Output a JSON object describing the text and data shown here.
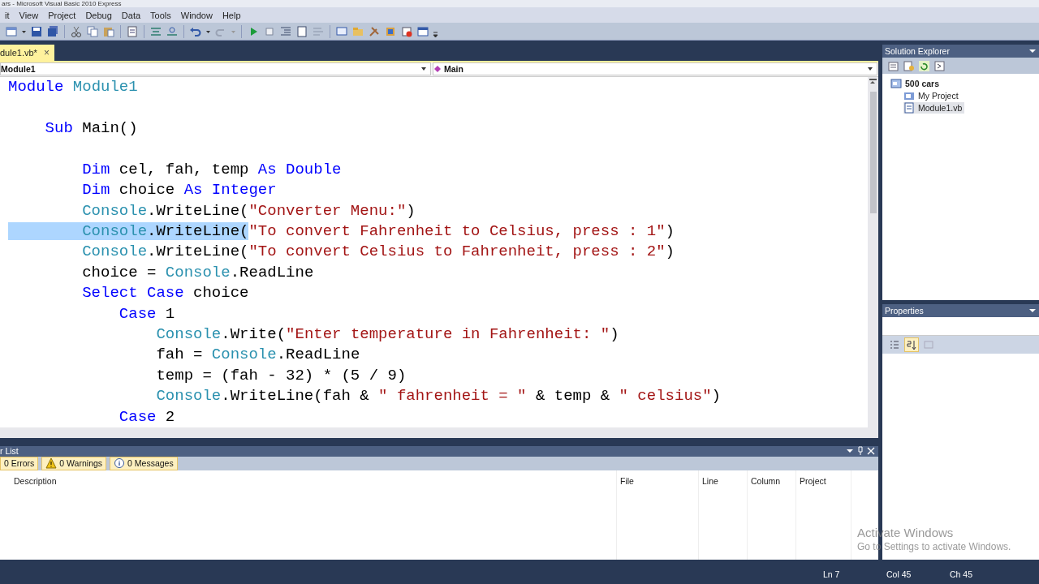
{
  "window": {
    "title": "ars - Microsoft Visual Basic 2010 Express"
  },
  "menu": [
    "it",
    "View",
    "Project",
    "Debug",
    "Data",
    "Tools",
    "Window",
    "Help"
  ],
  "document_tabs": [
    {
      "label": "dule1.vb*",
      "close": "×",
      "selected": true
    }
  ],
  "navigation": {
    "type_dropdown": "Module1",
    "member_dropdown": "Main"
  },
  "code_lines": [
    {
      "kind": "code",
      "tokens": [
        {
          "kind": "keyword",
          "text": "Module"
        },
        {
          "kind": "type",
          "text": " Module1"
        }
      ]
    },
    {
      "kind": "blank"
    },
    {
      "kind": "code",
      "tokens": [
        {
          "kind": "keyword",
          "text": "    Sub"
        },
        {
          "kind": "plain",
          "text": " Main()"
        }
      ]
    },
    {
      "kind": "blank"
    },
    {
      "kind": "code",
      "tokens": [
        {
          "kind": "keyword",
          "text": "        Dim"
        },
        {
          "kind": "plain",
          "text": " cel, fah, temp "
        },
        {
          "kind": "keyword",
          "text": "As Double"
        }
      ]
    },
    {
      "kind": "code",
      "tokens": [
        {
          "kind": "keyword",
          "text": "        Dim"
        },
        {
          "kind": "plain",
          "text": " choice "
        },
        {
          "kind": "keyword",
          "text": "As Integer"
        }
      ]
    },
    {
      "kind": "code",
      "tokens": [
        {
          "kind": "type",
          "text": "        Console"
        },
        {
          "kind": "plain",
          "text": ".WriteLine("
        },
        {
          "kind": "string",
          "text": "\"Converter Menu:\""
        },
        {
          "kind": "plain",
          "text": ")"
        }
      ]
    },
    {
      "kind": "code",
      "tokens": [
        {
          "kind": "type",
          "text": "        Console",
          "selected": true
        },
        {
          "kind": "plain",
          "text": ".WriteLine(",
          "selected": true
        },
        {
          "kind": "string",
          "text": "\"To convert Fahrenheit to Celsius, press : 1\""
        },
        {
          "kind": "plain",
          "text": ")"
        }
      ]
    },
    {
      "kind": "code",
      "tokens": [
        {
          "kind": "type",
          "text": "        Console"
        },
        {
          "kind": "plain",
          "text": ".WriteLine("
        },
        {
          "kind": "string",
          "text": "\"To convert Celsius to Fahrenheit, press : 2\""
        },
        {
          "kind": "plain",
          "text": ")"
        }
      ]
    },
    {
      "kind": "code",
      "tokens": [
        {
          "kind": "plain",
          "text": "        choice = "
        },
        {
          "kind": "type",
          "text": "Console"
        },
        {
          "kind": "plain",
          "text": ".ReadLine"
        }
      ]
    },
    {
      "kind": "code",
      "tokens": [
        {
          "kind": "keyword",
          "text": "        Select Case"
        },
        {
          "kind": "plain",
          "text": " choice"
        }
      ]
    },
    {
      "kind": "code",
      "tokens": [
        {
          "kind": "keyword",
          "text": "            Case"
        },
        {
          "kind": "plain",
          "text": " 1"
        }
      ]
    },
    {
      "kind": "code",
      "tokens": [
        {
          "kind": "type",
          "text": "                Console"
        },
        {
          "kind": "plain",
          "text": ".Write("
        },
        {
          "kind": "string",
          "text": "\"Enter temperature in Fahrenheit: \""
        },
        {
          "kind": "plain",
          "text": ")"
        }
      ]
    },
    {
      "kind": "code",
      "tokens": [
        {
          "kind": "plain",
          "text": "                fah = "
        },
        {
          "kind": "type",
          "text": "Console"
        },
        {
          "kind": "plain",
          "text": ".ReadLine"
        }
      ]
    },
    {
      "kind": "code",
      "tokens": [
        {
          "kind": "plain",
          "text": "                temp = (fah - 32) * (5 / 9)"
        }
      ]
    },
    {
      "kind": "code",
      "tokens": [
        {
          "kind": "type",
          "text": "                Console"
        },
        {
          "kind": "plain",
          "text": ".WriteLine(fah & "
        },
        {
          "kind": "string",
          "text": "\" fahrenheit = \""
        },
        {
          "kind": "plain",
          "text": " & temp & "
        },
        {
          "kind": "string",
          "text": "\" celsius\""
        },
        {
          "kind": "plain",
          "text": ")"
        }
      ]
    },
    {
      "kind": "code",
      "tokens": [
        {
          "kind": "keyword",
          "text": "            Case"
        },
        {
          "kind": "plain",
          "text": " 2"
        }
      ]
    }
  ],
  "error_list": {
    "title": "r List",
    "filters": [
      {
        "kind": "error",
        "label": "0 Errors",
        "selected": true
      },
      {
        "kind": "warning",
        "label": "0 Warnings",
        "selected": true
      },
      {
        "kind": "info",
        "label": "0 Messages",
        "selected": true
      }
    ],
    "columns": [
      "Description",
      "File",
      "Line",
      "Column",
      "Project"
    ]
  },
  "solution_explorer": {
    "title": "Solution Explorer",
    "tree": [
      {
        "kind": "solution",
        "label": "500 cars",
        "selected": false,
        "children": [
          {
            "kind": "project",
            "label": "My Project",
            "selected": false
          },
          {
            "kind": "file",
            "label": "Module1.vb",
            "selected": true
          }
        ]
      }
    ]
  },
  "properties": {
    "title": "Properties",
    "sort_buttons": [
      {
        "kind": "categorized",
        "selected": false
      },
      {
        "kind": "alphabetical",
        "selected": true
      },
      {
        "kind": "pages",
        "selected": false
      }
    ]
  },
  "activation_notice": {
    "heading": "Activate Windows",
    "body": "Go to Settings to activate Windows."
  },
  "status_bar": [
    "Ln 7",
    "Col 45",
    "Ch 45"
  ]
}
